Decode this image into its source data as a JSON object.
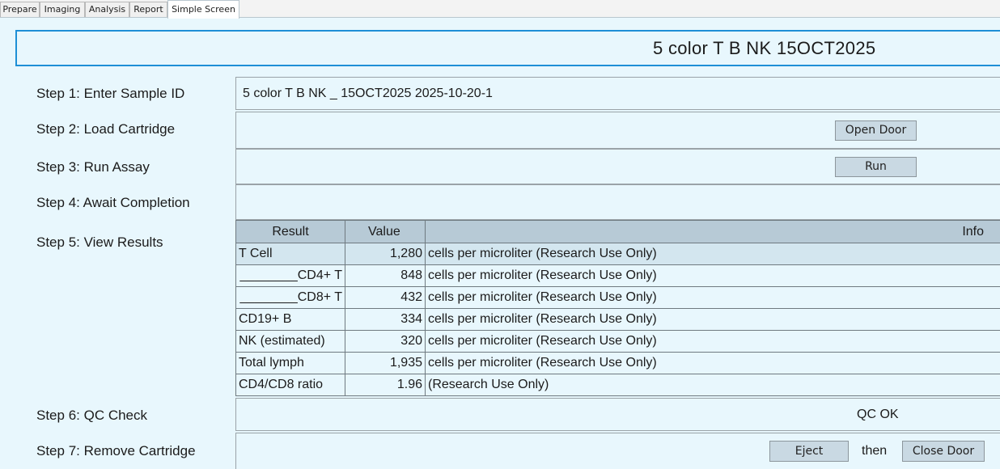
{
  "tabs": [
    {
      "label": "Prepare",
      "active": false
    },
    {
      "label": "Imaging",
      "active": false
    },
    {
      "label": "Analysis",
      "active": false
    },
    {
      "label": "Report",
      "active": false
    },
    {
      "label": "Simple Screen",
      "active": true
    }
  ],
  "title": "5 color T B NK  15OCT2025",
  "steps": {
    "s1": "Step 1: Enter Sample ID",
    "s2": "Step 2: Load Cartridge",
    "s3": "Step 3: Run Assay",
    "s4": "Step 4: Await Completion",
    "s5": "Step 5: View Results",
    "s6": "Step 6: QC Check",
    "s7": "Step 7: Remove Cartridge"
  },
  "sample_id": "5 color T B NK _ 15OCT2025 2025-10-20-1",
  "buttons": {
    "open_door": "Open Door",
    "run": "Run",
    "eject": "Eject",
    "then": "then",
    "close_door": "Close Door"
  },
  "qc_status": "QC OK",
  "results": {
    "headers": {
      "result": "Result",
      "value": "Value",
      "info": "Info"
    },
    "rows": [
      {
        "result": "T Cell",
        "value": "1,280",
        "info": "cells per microliter (Research Use Only)"
      },
      {
        "result": "________CD4+ T",
        "value": "848",
        "info": "cells per microliter (Research Use Only)"
      },
      {
        "result": "________CD8+ T",
        "value": "432",
        "info": "cells per microliter (Research Use Only)"
      },
      {
        "result": "CD19+ B",
        "value": "334",
        "info": "cells per microliter (Research Use Only)"
      },
      {
        "result": "NK (estimated)",
        "value": "320",
        "info": "cells per microliter (Research Use Only)"
      },
      {
        "result": "Total lymph",
        "value": "1,935",
        "info": "cells per microliter (Research Use Only)"
      },
      {
        "result": "CD4/CD8 ratio",
        "value": "1.96",
        "info": "(Research Use Only)"
      }
    ]
  },
  "colors": {
    "background": "#e8f7fd",
    "banner_border": "#1e8fd6",
    "header_fill": "#b7cad6",
    "button_fill": "#c9d9e3",
    "selected_row": "#d3e6ef"
  }
}
